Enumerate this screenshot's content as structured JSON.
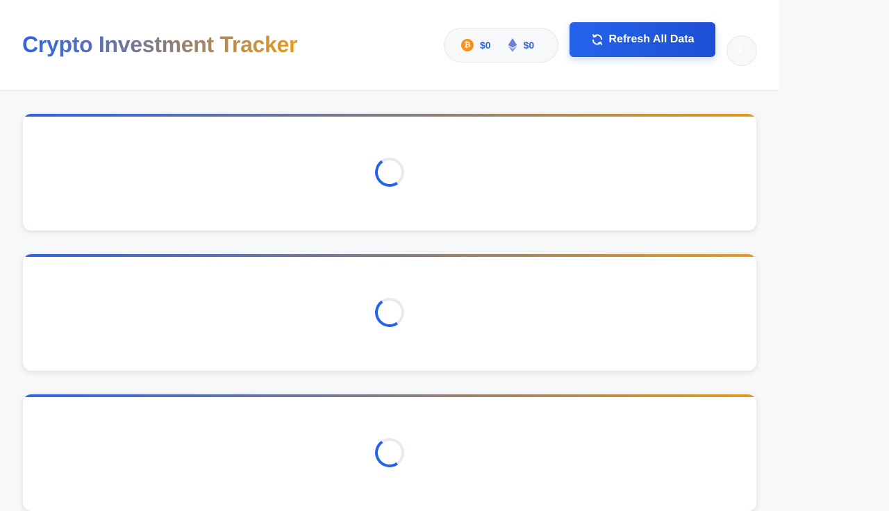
{
  "header": {
    "title": "Crypto Investment Tracker",
    "prices": [
      {
        "coin": "BTC",
        "icon": "bitcoin-icon",
        "symbol": "₿",
        "value": "$0",
        "color": "#f7931a"
      },
      {
        "coin": "ETH",
        "icon": "ethereum-icon",
        "value": "$0",
        "color": "#6b7fd8"
      }
    ],
    "refresh_label": "Refresh All Data",
    "refresh_icon": "refresh-icon",
    "theme_icon": "moon-icon"
  },
  "cards": [
    {
      "state": "loading"
    },
    {
      "state": "loading"
    },
    {
      "state": "loading"
    }
  ],
  "colors": {
    "accent": "#2563eb",
    "gradient_start": "#2f63e6",
    "gradient_end": "#e79b1c",
    "background": "#f6f8fa"
  }
}
